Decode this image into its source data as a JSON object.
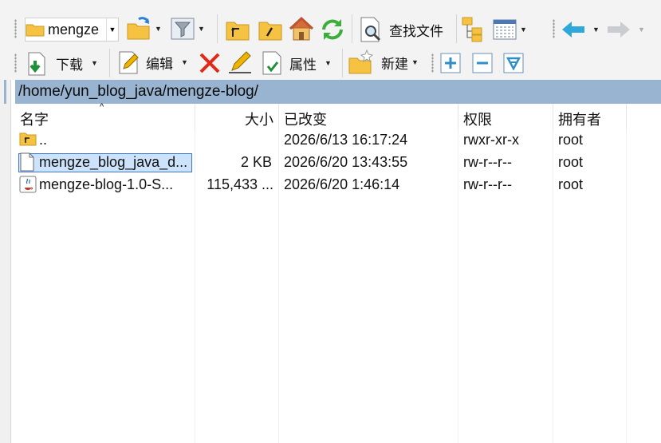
{
  "toolbar1": {
    "drive_label": "mengze",
    "find_files_label": "查找文件"
  },
  "toolbar2": {
    "download_label": "下载",
    "edit_label": "编辑",
    "properties_label": "属性",
    "new_label": "新建"
  },
  "path": "/home/yun_blog_java/mengze-blog/",
  "columns": {
    "name": "名字",
    "size": "大小",
    "changed": "已改变",
    "rights": "权限",
    "owner": "拥有者"
  },
  "files": [
    {
      "name": "..",
      "size": "",
      "changed": "2026/6/13 16:17:24",
      "rights": "rwxr-xr-x",
      "owner": "root",
      "icon": "parent-folder-icon"
    },
    {
      "name": "mengze_blog_java_d...",
      "size": "2 KB",
      "changed": "2026/6/20 13:43:55",
      "rights": "rw-r--r--",
      "owner": "root",
      "icon": "file-icon",
      "selected": true
    },
    {
      "name": "mengze-blog-1.0-S...",
      "size": "115,433 ...",
      "changed": "2026/6/20 1:46:14",
      "rights": "rw-r--r--",
      "owner": "root",
      "icon": "java-file-icon"
    }
  ],
  "colors": {
    "path_bar": "#99b4d1",
    "selection": "#cde3fb",
    "selection_border": "#3b78d8",
    "arrow_blue": "#2ea8d8",
    "folder_yellow": "#f5c242",
    "delete_red": "#e0291b",
    "refresh_green": "#3dae3d"
  }
}
